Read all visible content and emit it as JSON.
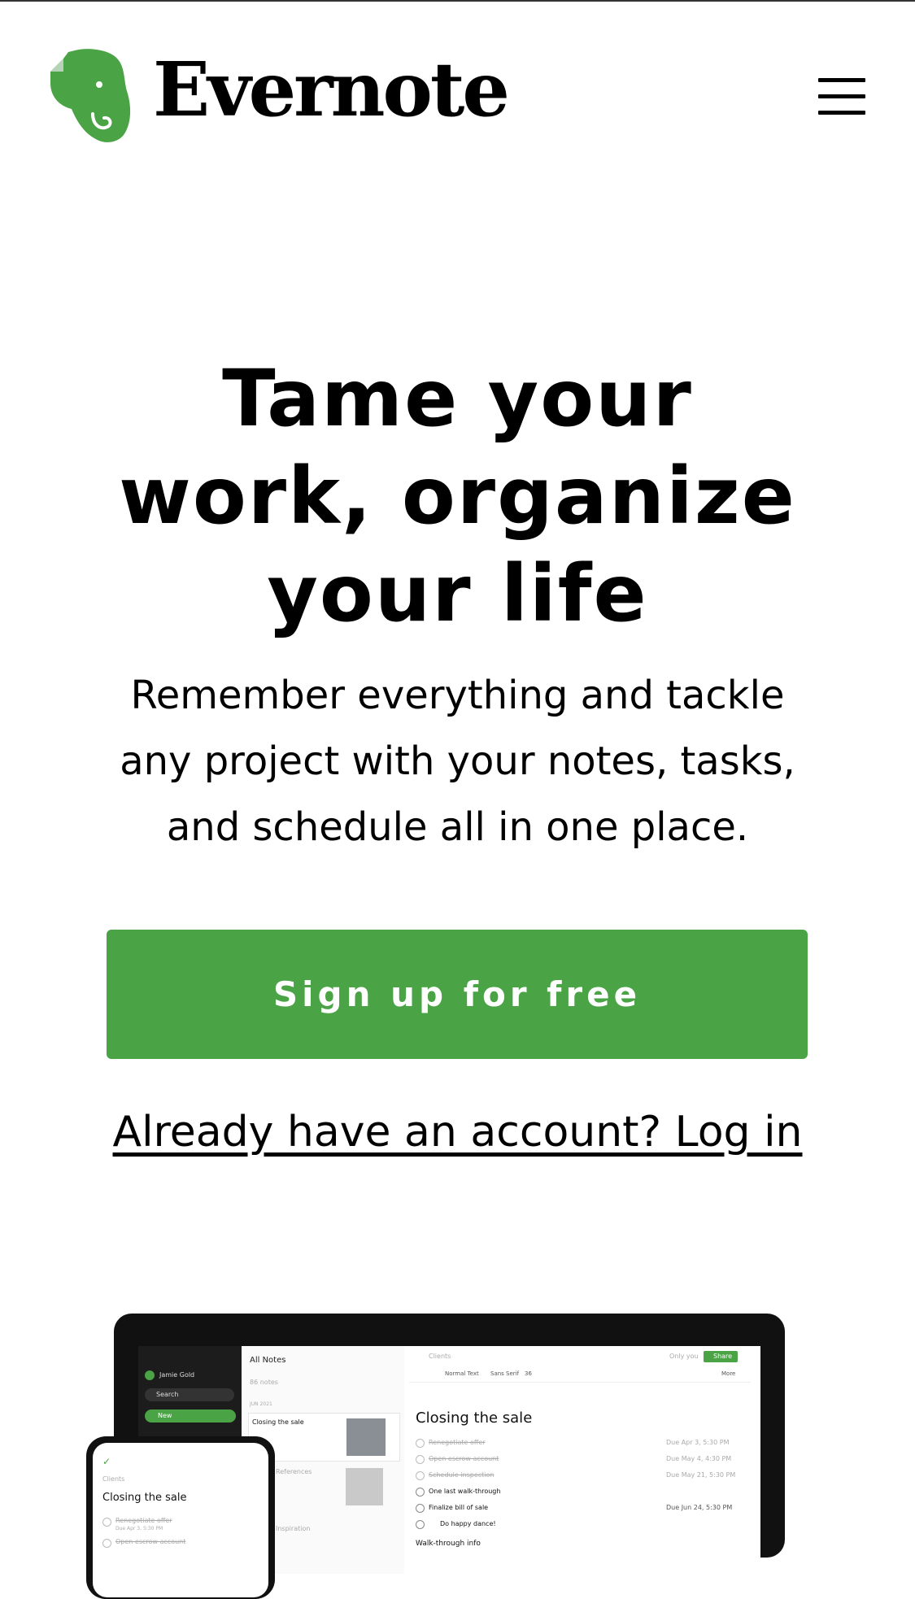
{
  "header": {
    "brand_name": "Evernote",
    "logo_icon": "evernote-elephant-icon",
    "menu_icon": "hamburger-menu-icon",
    "brand_color": "#4aa345"
  },
  "hero": {
    "title_line1": "Tame your",
    "title_line2": "work, organize",
    "title_line3": "your life",
    "subtitle_line1": "Remember everything and tackle",
    "subtitle_line2": "any project with your notes, tasks,",
    "subtitle_line3": "and schedule all in one place.",
    "cta_label": "Sign up for free",
    "cta_color": "#4aa345",
    "login_text": "Already have an account? Log in"
  },
  "mockup": {
    "laptop": {
      "sidebar_user": "Jamie Gold",
      "sidebar_search": "Search",
      "sidebar_new": "New",
      "list_header": "All Notes",
      "list_count": "86 notes",
      "list_date": "JUN 2021",
      "note1_title": "Closing the sale",
      "note2_title": "References",
      "note3_title": "Inspiration",
      "breadcrumb": "Clients",
      "only_you": "Only you",
      "share_label": "Share",
      "toolbar_text_style": "Normal Text",
      "toolbar_font": "Sans Serif",
      "toolbar_size": "36",
      "toolbar_more": "More",
      "editor_title": "Closing the sale",
      "tasks": [
        {
          "label": "Renegotiate offer",
          "due": "Due Apr 3, 5:30 PM",
          "done": true
        },
        {
          "label": "Open escrow account",
          "due": "Due May 4, 4:30 PM",
          "done": true
        },
        {
          "label": "Schedule inspection",
          "due": "Due May 21, 5:30 PM",
          "done": true
        },
        {
          "label": "One last walk-through",
          "due": "",
          "done": false
        },
        {
          "label": "Finalize bill of sale",
          "due": "Due Jun 24, 5:30 PM",
          "done": false
        },
        {
          "label": "Do happy dance!",
          "due": "",
          "done": false
        }
      ],
      "section_heading": "Walk-through info"
    },
    "phone": {
      "breadcrumb": "Clients",
      "title": "Closing the sale",
      "task1": "Renegotiate offer",
      "task1_due": "Due Apr 3, 5:30 PM",
      "task2": "Open escrow account"
    }
  }
}
